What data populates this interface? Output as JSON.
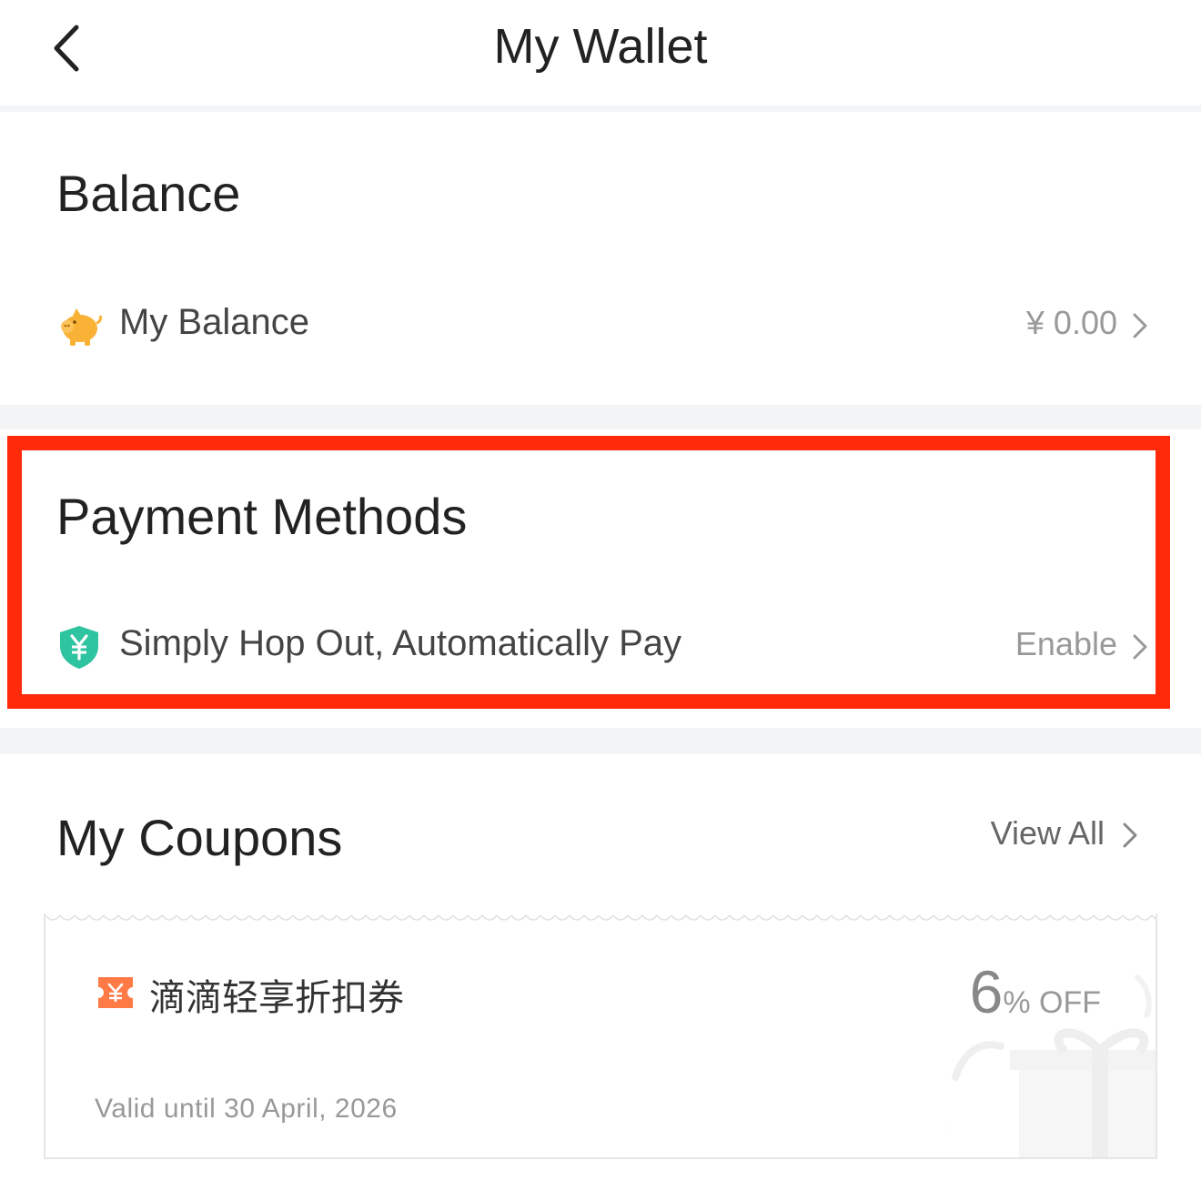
{
  "header": {
    "title": "My Wallet",
    "back_icon": "chevron-left-icon"
  },
  "balance": {
    "section_title": "Balance",
    "row_label": "My Balance",
    "row_value": "¥ 0.00",
    "icon": "piggy-bank-icon"
  },
  "payment": {
    "section_title": "Payment Methods",
    "row_label": "Simply Hop Out, Automatically Pay",
    "row_value": "Enable",
    "icon": "shield-yuan-icon",
    "highlighted": true
  },
  "coupons": {
    "section_title": "My Coupons",
    "view_all_label": "View All",
    "items": [
      {
        "name": "滴滴轻享折扣券",
        "discount_value": "6",
        "discount_unit": "% OFF",
        "valid_until": "Valid until 30 April, 2026",
        "icon": "ticket-yuan-icon"
      }
    ]
  },
  "colors": {
    "highlight_border": "#ff2a0a",
    "background_gap": "#f3f4f6",
    "piggy_bank": "#f9b236",
    "shield": "#2ec4a0",
    "coupon_icon": "#ff7a45",
    "muted_text": "#999999"
  }
}
